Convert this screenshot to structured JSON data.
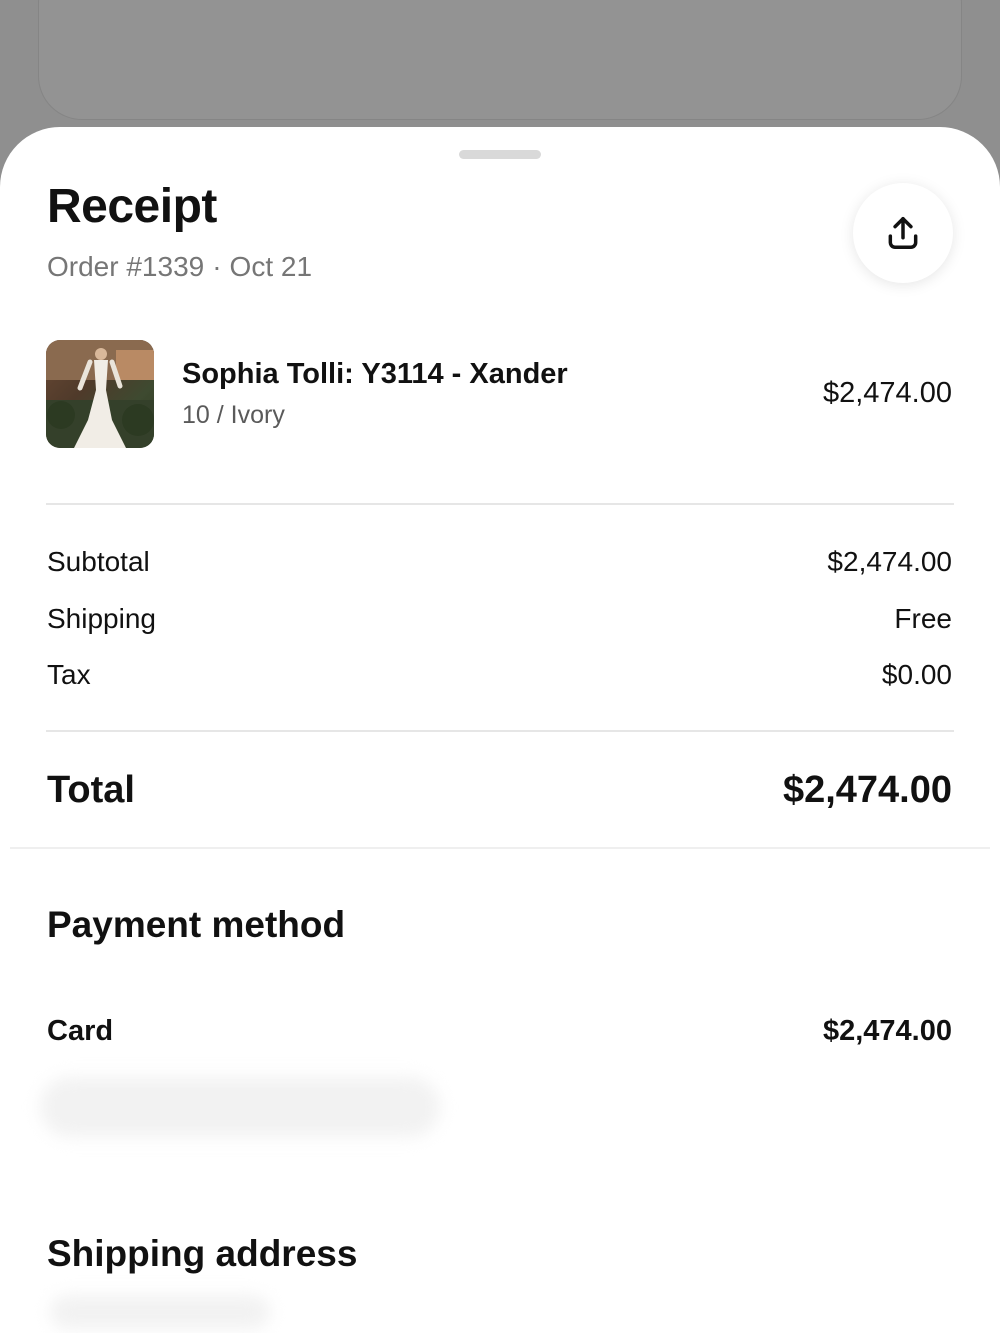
{
  "receipt": {
    "title": "Receipt",
    "order_number": "Order #1339",
    "separator": "·",
    "date": "Oct 21",
    "share_icon": "share-icon"
  },
  "item": {
    "name": "Sophia Tolli: Y3114 - Xander",
    "variant": "10 / Ivory",
    "price": "$2,474.00"
  },
  "summary": {
    "subtotal_label": "Subtotal",
    "subtotal_value": "$2,474.00",
    "shipping_label": "Shipping",
    "shipping_value": "Free",
    "tax_label": "Tax",
    "tax_value": "$0.00",
    "total_label": "Total",
    "total_value": "$2,474.00"
  },
  "payment": {
    "title": "Payment method",
    "card_label": "Card",
    "card_value": "$2,474.00"
  },
  "shipping_address": {
    "title": "Shipping address"
  }
}
